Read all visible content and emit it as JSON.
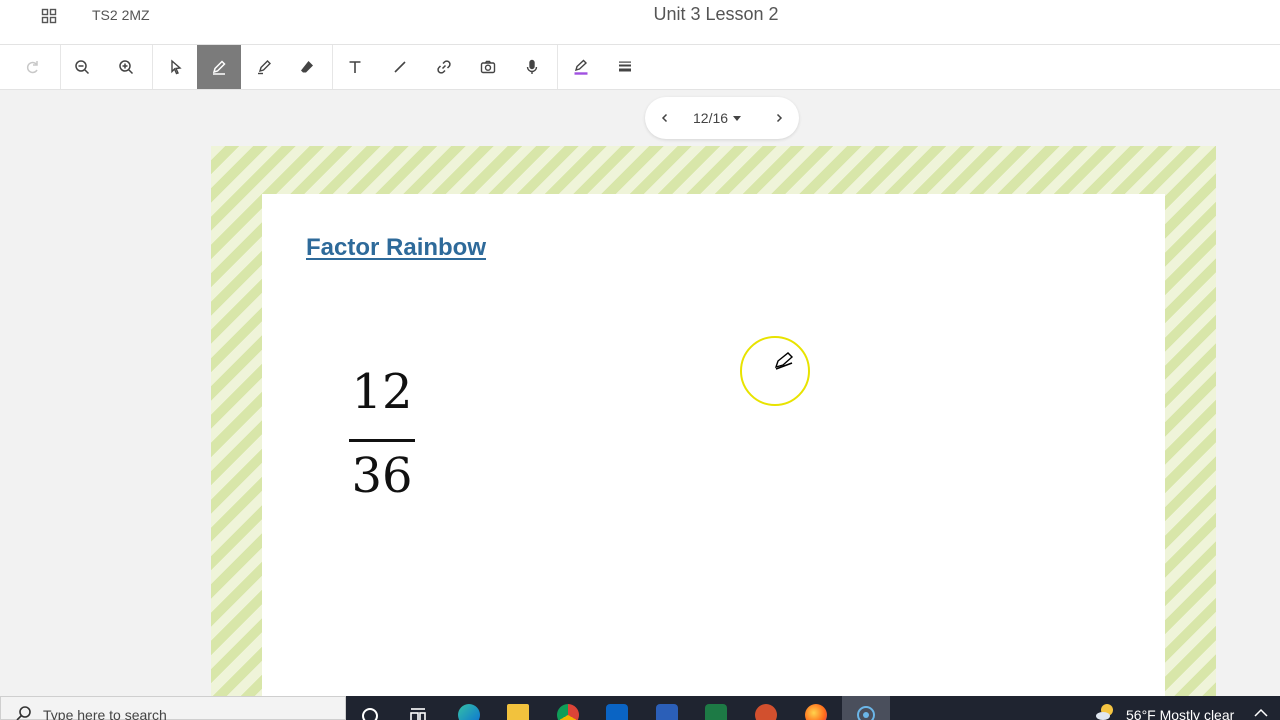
{
  "header": {
    "class_code": "TS2 2MZ",
    "title": "Unit 3 Lesson 2"
  },
  "toolbar": {
    "tools": [
      "redo-icon",
      "zoom-out-icon",
      "zoom-in-icon",
      "select-icon",
      "pen-icon",
      "highlighter-icon",
      "eraser-icon",
      "text-icon",
      "line-icon",
      "link-icon",
      "camera-icon",
      "microphone-icon",
      "pen-color-icon",
      "line-weight-icon"
    ],
    "active_tool": "pen-icon",
    "pen_color": "#a050e0"
  },
  "pager": {
    "page": "12/16"
  },
  "slide": {
    "title": "Factor Rainbow",
    "numerator": "12",
    "denominator": "36"
  },
  "taskbar": {
    "search_placeholder": "Type here to search",
    "apps": [
      "cortana-icon",
      "task-view-icon",
      "edge-icon",
      "file-explorer-icon",
      "chrome-icon",
      "outlook-icon",
      "word-icon",
      "excel-icon",
      "powerpoint-icon",
      "firefox-icon",
      "screen-recorder-icon"
    ],
    "weather": "56°F  Mostly clear"
  },
  "colors": {
    "title_blue": "#2e6a9a",
    "cursor_ring": "#e8e300",
    "active_tool_bg": "#7b7b7b"
  }
}
